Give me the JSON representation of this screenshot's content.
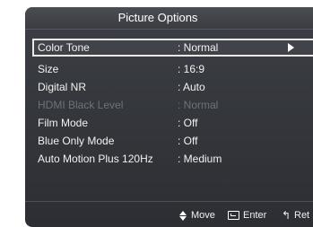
{
  "title": "Picture Options",
  "rows": [
    {
      "label": "Color Tone",
      "value": ": Normal",
      "selected": true,
      "enabled": true
    },
    {
      "label": "Size",
      "value": ": 16:9",
      "selected": false,
      "enabled": true
    },
    {
      "label": "Digital NR",
      "value": ": Auto",
      "selected": false,
      "enabled": true
    },
    {
      "label": "HDMI Black Level",
      "value": ": Normal",
      "selected": false,
      "enabled": false
    },
    {
      "label": "Film Mode",
      "value": ": Off",
      "selected": false,
      "enabled": true
    },
    {
      "label": "Blue Only Mode",
      "value": ": Off",
      "selected": false,
      "enabled": true
    },
    {
      "label": "Auto Motion Plus 120Hz",
      "value": ": Medium",
      "selected": false,
      "enabled": true
    }
  ],
  "footer": {
    "move": {
      "label": "Move",
      "icon": "up-down-arrows-icon"
    },
    "enter": {
      "label": "Enter",
      "icon": "enter-icon"
    },
    "return": {
      "label": "Ret",
      "icon": "return-icon"
    }
  },
  "colors": {
    "background": "#2c2e33",
    "text": "#f2f2f2",
    "disabled_text": "#6f7277",
    "highlight_border": "#e8e8e8"
  }
}
